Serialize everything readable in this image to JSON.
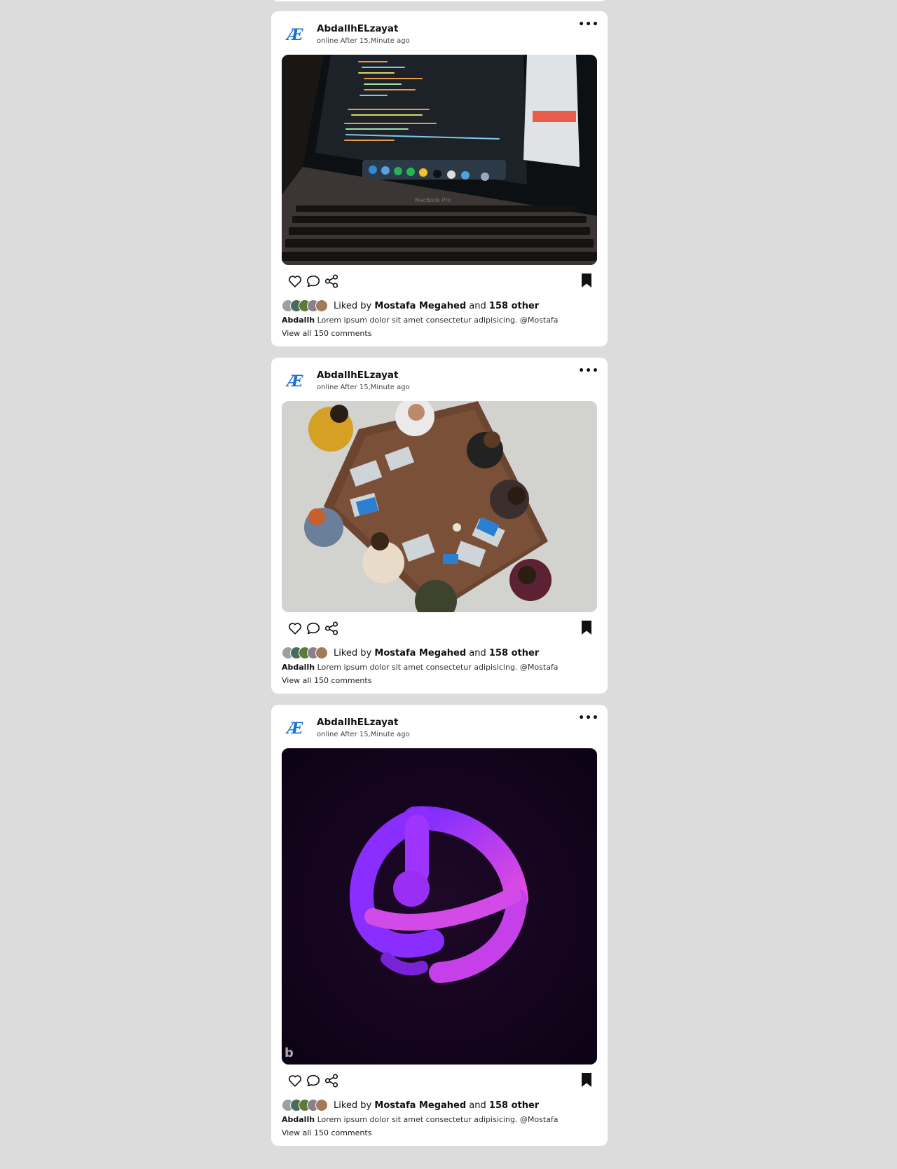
{
  "colors": {
    "page_bg": "#dcdcdc",
    "card_bg": "#ffffff",
    "text": "#111111"
  },
  "posts": [
    {
      "username": "AbdallhELzayat",
      "status": "online After 15,Minute ago",
      "image_icon": "laptop-code-photo",
      "liked_by_prefix": "Liked by",
      "liked_by_name": "Mostafa Megahed",
      "liked_by_and": "and",
      "liked_by_count": "158 other",
      "caption_user": "Abdallh",
      "caption_text": "Lorem ipsum dolor sit amet consectetur adipisicing. @Mostafa",
      "view_comments": "View all 150 comments"
    },
    {
      "username": "AbdallhELzayat",
      "status": "online After 15,Minute ago",
      "image_icon": "team-meeting-photo",
      "liked_by_prefix": "Liked by",
      "liked_by_name": "Mostafa Megahed",
      "liked_by_and": "and",
      "liked_by_count": "158 other",
      "caption_user": "Abdallh",
      "caption_text": "Lorem ipsum dolor sit amet consectetur adipisicing. @Mostafa",
      "view_comments": "View all 150 comments"
    },
    {
      "username": "AbdallhELzayat",
      "status": "online After 15,Minute ago",
      "image_icon": "purple-logo-art",
      "liked_by_prefix": "Liked by",
      "liked_by_name": "Mostafa Megahed",
      "liked_by_and": "and",
      "liked_by_count": "158 other",
      "caption_user": "Abdallh",
      "caption_text": "Lorem ipsum dolor sit amet consectetur adipisicing. @Mostafa",
      "view_comments": "View all 150 comments"
    }
  ]
}
